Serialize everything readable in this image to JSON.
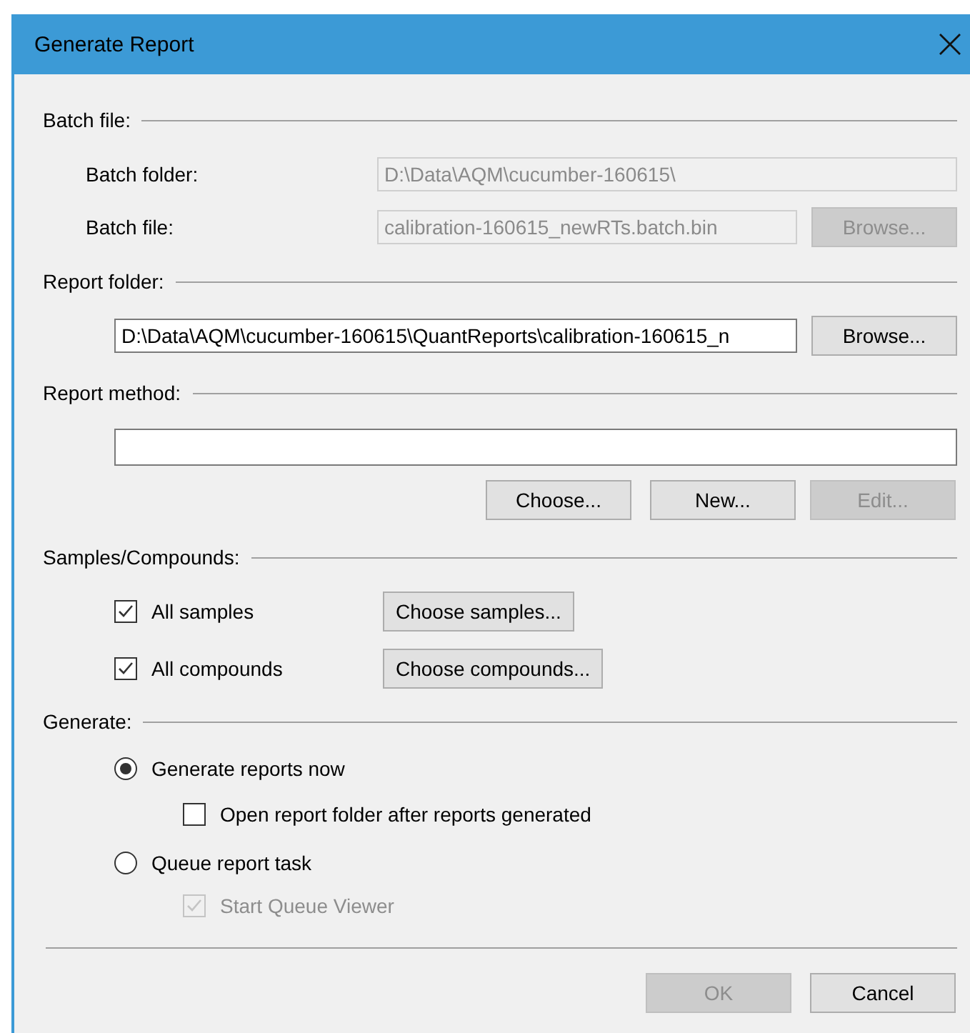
{
  "window": {
    "title": "Generate Report"
  },
  "batch_file": {
    "heading": "Batch file:",
    "batch_folder": {
      "label": "Batch folder:",
      "value": "D:\\Data\\AQM\\cucumber-160615\\",
      "disabled": true
    },
    "batch_file": {
      "label": "Batch file:",
      "value": "calibration-160615_newRTs.batch.bin",
      "disabled": true,
      "button": {
        "label": "Browse...",
        "disabled": true
      }
    }
  },
  "report_folder": {
    "heading": "Report folder:",
    "value": "D:\\Data\\AQM\\cucumber-160615\\QuantReports\\calibration-160615_n",
    "button": {
      "label": "Browse...",
      "disabled": false
    }
  },
  "report_method": {
    "heading": "Report method:",
    "buttons": [
      {
        "label": "Choose...",
        "disabled": false
      },
      {
        "label": "New...",
        "disabled": false
      },
      {
        "label": "Edit...",
        "disabled": true
      }
    ]
  },
  "samples_compounds": {
    "heading": "Samples/Compounds:",
    "options": [
      {
        "label": "All samples",
        "checked": true,
        "button": {
          "label": "Choose samples...",
          "disabled": false
        }
      },
      {
        "label": "All compounds",
        "checked": true,
        "button": {
          "label": "Choose compounds...",
          "disabled": false
        }
      }
    ]
  },
  "generate": {
    "heading": "Generate:",
    "options": [
      {
        "label": "Generate reports now",
        "selected": true,
        "children": [
          {
            "label": "Open report folder after reports generated",
            "checked": false,
            "disabled": false
          }
        ]
      },
      {
        "label": "Queue report task",
        "selected": false,
        "children": [
          {
            "label": "Start Queue Viewer",
            "checked": true,
            "disabled": true
          }
        ]
      }
    ]
  },
  "buttons": [
    {
      "label": "OK",
      "disabled": true
    },
    {
      "label": "Cancel",
      "disabled": false
    }
  ]
}
